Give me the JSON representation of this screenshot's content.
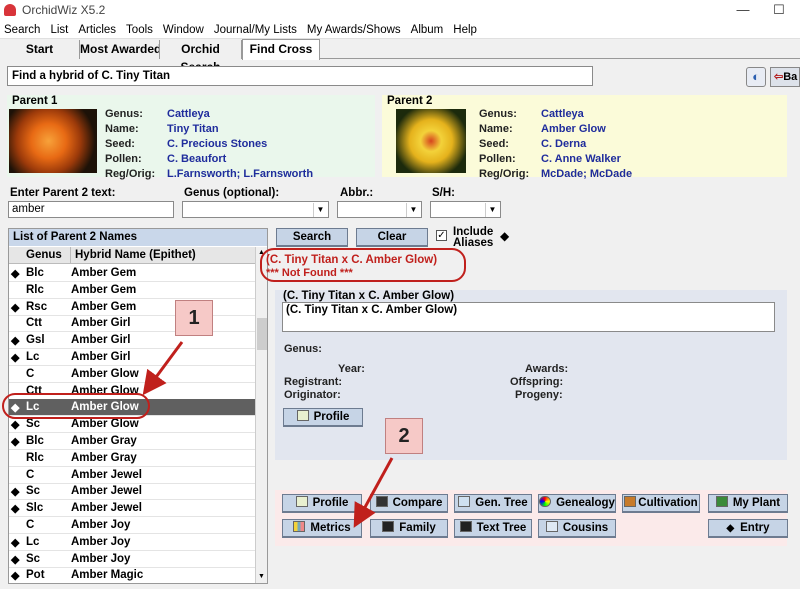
{
  "app": {
    "title": "OrchidWiz X5.2"
  },
  "menu": [
    "Search",
    "List",
    "Articles",
    "Tools",
    "Window",
    "Journal/My Lists",
    "My Awards/Shows",
    "Album",
    "Help"
  ],
  "tabs": [
    "Start",
    "Most Awarded",
    "Orchid Search",
    "Find Cross"
  ],
  "find": {
    "text": "Find a hybrid of C. Tiny Titan",
    "back_label": "Ba"
  },
  "parent1": {
    "header": "Parent 1",
    "labels": {
      "genus": "Genus:",
      "name": "Name:",
      "seed": "Seed:",
      "pollen": "Pollen:",
      "reg": "Reg/Orig:"
    },
    "genus": "Cattleya",
    "name": "Tiny Titan",
    "seed": "C. Precious Stones",
    "pollen": "C. Beaufort",
    "reg": "L.Farnsworth; L.Farnsworth"
  },
  "parent2": {
    "header": "Parent 2",
    "labels": {
      "genus": "Genus:",
      "name": "Name:",
      "seed": "Seed:",
      "pollen": "Pollen:",
      "reg": "Reg/Orig:"
    },
    "genus": "Cattleya",
    "name": "Amber Glow",
    "seed": "C. Derna",
    "pollen": "C. Anne Walker",
    "reg": "McDade; McDade"
  },
  "filters": {
    "parent2_label": "Enter Parent 2 text:",
    "parent2_value": "amber",
    "genus_label": "Genus (optional):",
    "abbr_label": "Abbr.:",
    "sh_label": "S/H:"
  },
  "list": {
    "title": "List of Parent 2 Names",
    "col_genus": "Genus",
    "col_name": "Hybrid Name (Epithet)",
    "rows": [
      {
        "g": "Blc",
        "n": "Amber Gem",
        "a": true
      },
      {
        "g": "Rlc",
        "n": "Amber Gem",
        "a": false
      },
      {
        "g": "Rsc",
        "n": "Amber Gem",
        "a": true
      },
      {
        "g": "Ctt",
        "n": "Amber Girl",
        "a": false
      },
      {
        "g": "Gsl",
        "n": "Amber Girl",
        "a": true
      },
      {
        "g": "Lc",
        "n": "Amber Girl",
        "a": true
      },
      {
        "g": "C",
        "n": "Amber Glow",
        "a": false
      },
      {
        "g": "Ctt",
        "n": "Amber Glow",
        "a": false
      },
      {
        "g": "Lc",
        "n": "Amber Glow",
        "a": true,
        "sel": true
      },
      {
        "g": "Sc",
        "n": "Amber Glow",
        "a": true
      },
      {
        "g": "Blc",
        "n": "Amber Gray",
        "a": true
      },
      {
        "g": "Rlc",
        "n": "Amber Gray",
        "a": false
      },
      {
        "g": "C",
        "n": "Amber Jewel",
        "a": false
      },
      {
        "g": "Sc",
        "n": "Amber Jewel",
        "a": true
      },
      {
        "g": "Slc",
        "n": "Amber Jewel",
        "a": true
      },
      {
        "g": "C",
        "n": "Amber Joy",
        "a": false
      },
      {
        "g": "Lc",
        "n": "Amber Joy",
        "a": true
      },
      {
        "g": "Sc",
        "n": "Amber Joy",
        "a": true
      },
      {
        "g": "Pot",
        "n": "Amber Magic",
        "a": true
      }
    ]
  },
  "search": {
    "search_label": "Search",
    "clear_label": "Clear",
    "include_label": "Include",
    "aliases_label": "Aliases"
  },
  "result": {
    "cross": "(C. Tiny Titan x C. Amber Glow)",
    "status": "*** Not Found ***"
  },
  "info": {
    "header": "(C. Tiny Titan x C. Amber Glow)",
    "field": "(C. Tiny Titan x C. Amber Glow)",
    "genus": "Genus:",
    "year": "Year:",
    "registrant": "Registrant:",
    "originator": "Originator:",
    "awards": "Awards:",
    "offspring": "Offspring:",
    "progeny": "Progeny:",
    "profile_label": "Profile"
  },
  "buttons": {
    "profile": "Profile",
    "compare": "Compare",
    "gentree": "Gen. Tree",
    "genealogy": "Genealogy",
    "cultivation": "Cultivation",
    "myplant": "My Plant",
    "metrics": "Metrics",
    "family": "Family",
    "texttree": "Text Tree",
    "cousins": "Cousins",
    "entry": "Entry"
  },
  "callouts": {
    "c1": "1",
    "c2": "2"
  },
  "colors": {
    "accent_red": "#c0201c",
    "link_blue": "#1f2c9c",
    "selection": "#606060"
  }
}
